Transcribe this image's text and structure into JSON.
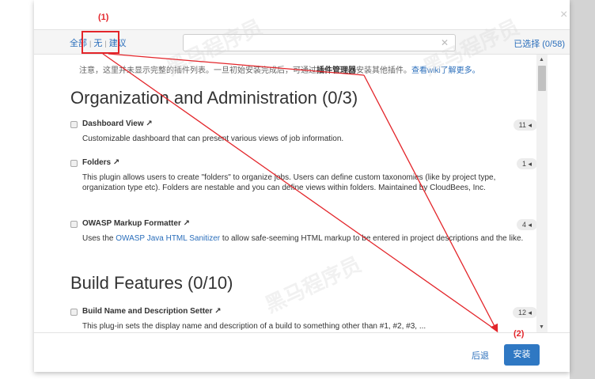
{
  "filter_links": {
    "all": "全部",
    "none": "无",
    "suggested": "建议",
    "separator": "|"
  },
  "search": {
    "value": "",
    "clear_symbol": "✕"
  },
  "selected_count": "已选择 (0/58)",
  "close_symbol": "×",
  "notice": {
    "prefix": "注意，这里并未显示完整的插件列表。一旦初始安装完成后，可通过",
    "bold": "插件管理器",
    "middle": "安装其他插件。",
    "link": "查看wiki了解更多。"
  },
  "sections": [
    {
      "title": "Organization and Administration (0/3)",
      "plugins": [
        {
          "name": "Dashboard View ↗",
          "badge": "11 ◂",
          "description": "Customizable dashboard that can present various views of job information."
        },
        {
          "name": "Folders ↗",
          "badge": "1 ◂",
          "description": "This plugin allows users to create \"folders\" to organize jobs. Users can define custom taxonomies (like by project type, organization type etc). Folders are nestable and you can define views within folders. Maintained by CloudBees, Inc."
        },
        {
          "name": "OWASP Markup Formatter ↗",
          "badge": "4 ◂",
          "description_prefix": "Uses the ",
          "description_link": "OWASP Java HTML Sanitizer",
          "description_suffix": " to allow safe-seeming HTML markup to be entered in project descriptions and the like."
        }
      ]
    },
    {
      "title": "Build Features (0/10)",
      "plugins": [
        {
          "name": "Build Name and Description Setter ↗",
          "badge": "12 ◂",
          "description": "This plug-in sets the display name and description of a build to something other than #1, #2, #3, ..."
        }
      ]
    }
  ],
  "footer": {
    "back_label": "后退",
    "install_label": "安装"
  },
  "annotations": {
    "label1": "(1)",
    "label2": "(2)",
    "color": "#e3252a"
  },
  "watermarks": [
    "黑马程序员",
    "www.itheima.com"
  ],
  "colors": {
    "link": "#2a6ebb",
    "primary_button": "#2f78c3"
  }
}
